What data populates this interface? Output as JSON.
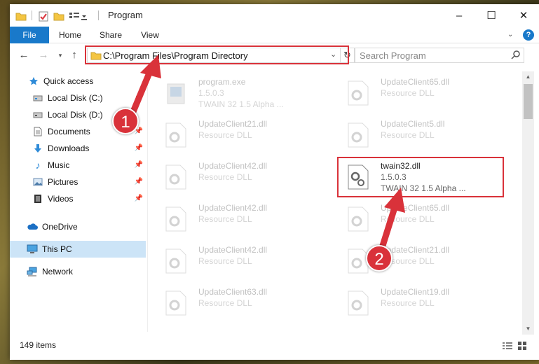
{
  "window": {
    "title": "Program",
    "controls": {
      "minimize": "–",
      "maximize": "☐",
      "close": "✕"
    }
  },
  "ribbon": {
    "tabs": [
      {
        "label": "File"
      },
      {
        "label": "Home"
      },
      {
        "label": "Share"
      },
      {
        "label": "View"
      }
    ],
    "help": "?"
  },
  "address_bar": {
    "path": "C:\\Program Files\\Program Directory"
  },
  "search": {
    "placeholder": "Search Program"
  },
  "sidebar": {
    "items": [
      {
        "label": "Quick access"
      },
      {
        "label": "Local Disk (C:)"
      },
      {
        "label": "Local Disk (D:)"
      },
      {
        "label": "Documents"
      },
      {
        "label": "Downloads"
      },
      {
        "label": "Music"
      },
      {
        "label": "Pictures"
      },
      {
        "label": "Videos"
      },
      {
        "label": "OneDrive"
      },
      {
        "label": "This PC"
      },
      {
        "label": "Network"
      }
    ]
  },
  "files": [
    {
      "name": "program.exe",
      "line2": "1.5.0.3",
      "line3": "TWAIN 32 1.5 Alpha ...",
      "icon": "exe-icon"
    },
    {
      "name": "UpdateClient65.dll",
      "line2": "Resource DLL"
    },
    {
      "name": "UpdateClient21.dll",
      "line2": "Resource DLL"
    },
    {
      "name": "UpdateClient5.dll",
      "line2": "Resource DLL"
    },
    {
      "name": "UpdateClient42.dll",
      "line2": "Resource DLL"
    },
    {
      "name": "twain32.dll",
      "line2": "1.5.0.3",
      "line3": "TWAIN 32 1.5 Alpha ...",
      "highlight": true
    },
    {
      "name": "UpdateClient42.dll",
      "line2": "Resource DLL"
    },
    {
      "name": "UpdateClient65.dll",
      "line2": "Resource DLL"
    },
    {
      "name": "UpdateClient42.dll",
      "line2": "Resource DLL"
    },
    {
      "name": "UpdateClient21.dll",
      "line2": "Resource DLL"
    },
    {
      "name": "UpdateClient63.dll",
      "line2": "Resource DLL"
    },
    {
      "name": "UpdateClient19.dll",
      "line2": "Resource DLL"
    }
  ],
  "status": {
    "item_count": "149 items"
  },
  "annotations": {
    "step1": "1",
    "step2": "2",
    "color": "#d9323a"
  }
}
